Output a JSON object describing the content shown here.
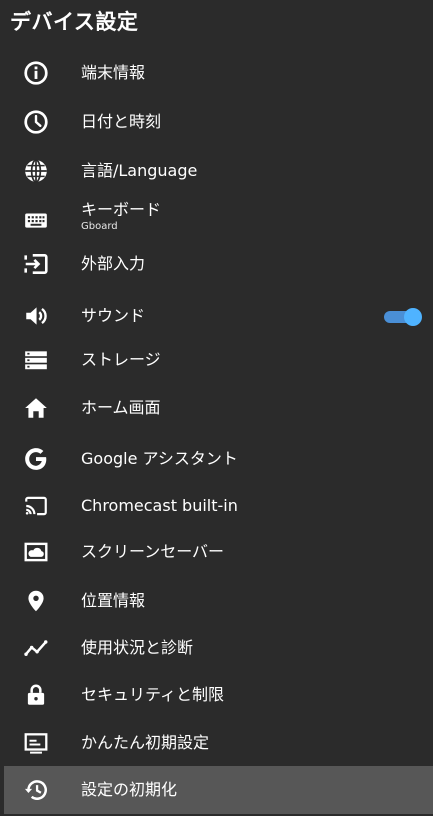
{
  "header": {
    "title": "デバイス設定"
  },
  "accent_color": "#4fb3ff",
  "selected_bg": "#575757",
  "items": [
    {
      "icon": "info-icon",
      "label": "端末情報"
    },
    {
      "icon": "clock-icon",
      "label": "日付と時刻"
    },
    {
      "icon": "globe-icon",
      "label": "言語/Language"
    },
    {
      "icon": "keyboard-icon",
      "label": "キーボード",
      "sublabel": "Gboard"
    },
    {
      "icon": "input-icon",
      "label": "外部入力"
    },
    {
      "icon": "volume-icon",
      "label": "サウンド",
      "toggle_on": true
    },
    {
      "icon": "storage-icon",
      "label": "ストレージ"
    },
    {
      "icon": "home-icon",
      "label": "ホーム画面"
    },
    {
      "icon": "google-icon",
      "label": "Google アシスタント"
    },
    {
      "icon": "cast-icon",
      "label": "Chromecast built-in"
    },
    {
      "icon": "screensaver-icon",
      "label": "スクリーンセーバー"
    },
    {
      "icon": "location-icon",
      "label": "位置情報"
    },
    {
      "icon": "analytics-icon",
      "label": "使用状況と診断"
    },
    {
      "icon": "lock-icon",
      "label": "セキュリティと制限"
    },
    {
      "icon": "setup-icon",
      "label": "かんたん初期設定"
    },
    {
      "icon": "restore-icon",
      "label": "設定の初期化",
      "selected": true
    }
  ]
}
